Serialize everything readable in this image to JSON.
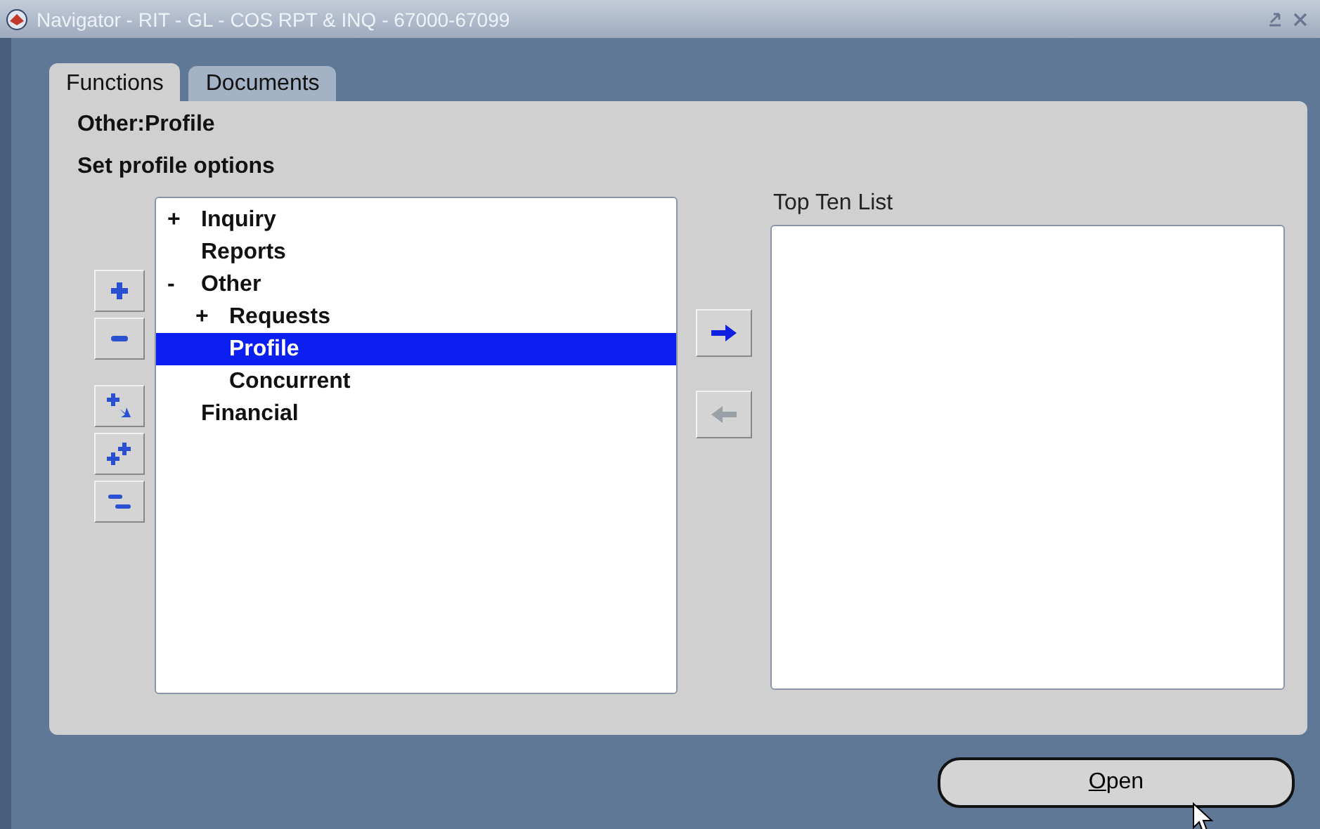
{
  "window": {
    "title": "Navigator - RIT - GL - COS RPT & INQ - 67000-67099"
  },
  "tabs": [
    {
      "label": "Functions",
      "selected": true
    },
    {
      "label": "Documents",
      "selected": false
    }
  ],
  "path": "Other:Profile",
  "description": "Set profile options",
  "tree": [
    {
      "label": "Inquiry",
      "toggle": "+",
      "selected": false
    },
    {
      "label": "Reports",
      "selected": false
    },
    {
      "label": "Other",
      "toggle": "-",
      "selected": false,
      "children": [
        {
          "label": "Requests",
          "toggle": "+",
          "selected": false
        },
        {
          "label": "Profile",
          "selected": true
        },
        {
          "label": "Concurrent",
          "selected": false
        }
      ]
    },
    {
      "label": "Financial",
      "selected": false
    }
  ],
  "top_ten": {
    "label": "Top Ten List"
  },
  "transfer_buttons": [
    {
      "kind": "add",
      "disabled": false
    },
    {
      "kind": "remove",
      "disabled": true
    }
  ],
  "open_button": {
    "label": "Open"
  }
}
